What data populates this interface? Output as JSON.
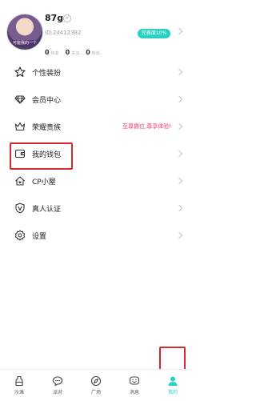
{
  "profile": {
    "avatar_caption": "可能我的一个",
    "username": "87g",
    "id_text": "ID:24412382",
    "stats": [
      {
        "value": "0",
        "label": "好友"
      },
      {
        "value": "0",
        "label": "关注"
      },
      {
        "value": "0",
        "label": "粉丝"
      }
    ],
    "completion_badge": "完善度10%"
  },
  "menu": [
    {
      "label": "个性装扮",
      "icon": "star-icon"
    },
    {
      "label": "会员中心",
      "icon": "diamond-icon"
    },
    {
      "label": "荣耀贵族",
      "icon": "crown-icon",
      "note": "至尊爵位,尊享体验!"
    },
    {
      "label": "我的钱包",
      "icon": "wallet-icon"
    },
    {
      "label": "CP小屋",
      "icon": "house-icon"
    },
    {
      "label": "真人认证",
      "icon": "verified-shield-icon"
    },
    {
      "label": "设置",
      "icon": "gear-icon"
    }
  ],
  "tabs": [
    {
      "label": "沙滩",
      "icon": "bottle-icon"
    },
    {
      "label": "派对",
      "icon": "party-chat-icon"
    },
    {
      "label": "广场",
      "icon": "compass-icon"
    },
    {
      "label": "消息",
      "icon": "message-icon"
    },
    {
      "label": "我的",
      "icon": "person-icon",
      "active": true
    }
  ],
  "colors": {
    "accent": "#2ad1c2",
    "highlight_box": "#d8282d",
    "note_text": "#ff3b6b"
  }
}
